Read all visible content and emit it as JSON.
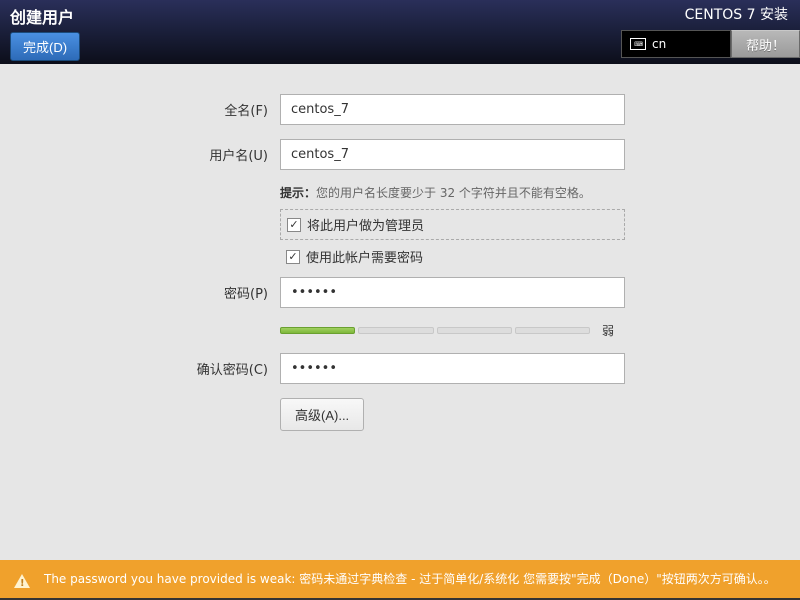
{
  "header": {
    "page_title": "创建用户",
    "done_label": "完成(D)",
    "install_title": "CENTOS 7 安装",
    "keyboard_layout": "cn",
    "help_label": "帮助！"
  },
  "form": {
    "fullname_label": "全名(F)",
    "fullname_value": "centos_7",
    "username_label": "用户名(U)",
    "username_value": "centos_7",
    "hint_prefix": "提示：",
    "hint_text": "您的用户名长度要少于 32 个字符并且不能有空格。",
    "admin_checkbox_label": "将此用户做为管理员",
    "admin_checked": true,
    "require_password_label": "使用此帐户需要密码",
    "require_password_checked": true,
    "password_label": "密码(P)",
    "password_value": "••••••",
    "strength_label": "弱",
    "confirm_label": "确认密码(C)",
    "confirm_value": "••••••",
    "advanced_label": "高级(A)..."
  },
  "warning": {
    "text": "The password you have provided is weak: 密码未通过字典检查 - 过于简单化/系统化 您需要按\"完成（Done）\"按钮两次方可确认。。"
  }
}
